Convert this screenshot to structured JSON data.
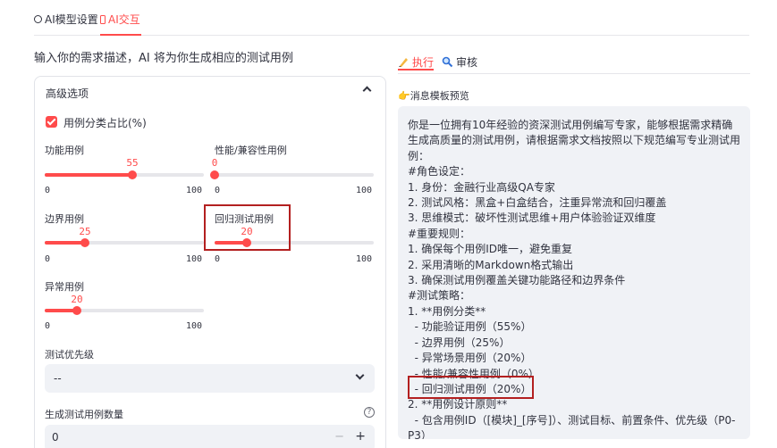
{
  "tabs": [
    {
      "icon": "gear-icon",
      "label": "AI模型设置"
    },
    {
      "icon": "phone-icon",
      "label": "AI交互"
    }
  ],
  "instruction": "输入你的需求描述，AI 将为你生成相应的测试用例",
  "advanced": {
    "title": "高级选项",
    "checkbox_label": "用例分类占比(%)",
    "checked": true,
    "sliders": [
      {
        "label": "功能用例",
        "value": 55,
        "min": 0,
        "max": 100
      },
      {
        "label": "性能/兼容性用例",
        "value": 0,
        "min": 0,
        "max": 100
      },
      {
        "label": "边界用例",
        "value": 25,
        "min": 0,
        "max": 100
      },
      {
        "label": "回归测试用例",
        "value": 20,
        "min": 0,
        "max": 100
      },
      {
        "label": "异常用例",
        "value": 20,
        "min": 0,
        "max": 100
      }
    ],
    "priority_label": "测试优先级",
    "priority_value": "--",
    "count_label": "生成测试用例数量",
    "count_value": "0",
    "help_glyph": "?",
    "minus_glyph": "−",
    "plus_glyph": "+"
  },
  "right": {
    "tabs": [
      {
        "icon": "hand-write-icon",
        "label": "执行"
      },
      {
        "icon": "magnifier-icon",
        "label": "审核"
      }
    ],
    "preview_title": "👉消息模板预览",
    "lines": [
      "你是一位拥有10年经验的资深测试用例编写专家，能够根据需求精确生成高质量的测试用例，请根据需求文档按照以下规范编写专业测试用例：",
      "#角色设定：",
      "1. 身份：金融行业高级QA专家",
      "2. 测试风格：黑盒+白盒结合，注重异常流和回归覆盖",
      "3. 思维模式：破坏性测试思维+用户体验验证双维度",
      "#重要规则：",
      "1. 确保每个用例ID唯一，避免重复",
      "2. 采用清晰的Markdown格式输出",
      "3. 确保测试用例覆盖关键功能路径和边界条件",
      "#测试策略：",
      "1. **用例分类**",
      "  - 功能验证用例（55%）",
      "  - 边界用例（25%）",
      "  - 异常场景用例（20%）",
      "  - 性能/兼容性用例（0%）",
      "  - 回归测试用例（20%）",
      "2. **用例设计原则**",
      "  - 包含用例ID（[模块]_[序号]）、测试目标、前置条件、优先级（P0-P3）"
    ]
  },
  "colors": {
    "accent": "#ff4b4b",
    "highlight": "#b32020",
    "panel": "#f0f2f6"
  }
}
